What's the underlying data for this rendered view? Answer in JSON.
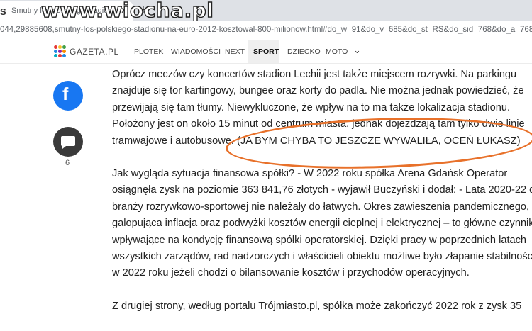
{
  "browser": {
    "favicon": "S",
    "tab_title": "Smutny los polskiego stadionu n",
    "close_icon": "close-icon",
    "new_tab_icon": "plus-icon",
    "url": "044,29885608,smutny-los-polskiego-stadionu-na-euro-2012-kosztowal-800-milionow.html#do_w=91&do_v=685&do_st=RS&do_sid=768&do_a=768&"
  },
  "watermark": "www.wiocha.pl",
  "site": {
    "logo_text": "GAZETA.PL",
    "nav": [
      "PLOTEK",
      "WIADOMOŚCI",
      "NEXT",
      "SPORT",
      "DZIECKO",
      "MOTO"
    ],
    "active": "SPORT",
    "more_icon": "chevron-down-icon"
  },
  "share": {
    "facebook_icon": "facebook-icon",
    "comment_icon": "comment-icon",
    "comment_count": "6"
  },
  "article": {
    "p1": [
      "Oprócz meczów czy koncertów stadion Lechii jest także miejscem rozrywki. Na parkingu",
      "znajduje się tor kartingowy, bungee oraz korty do padla. Nie można jednak powiedzieć, że",
      "przewijają się tam tłumy. Niewykluczone, że wpływ na to ma także lokalizacja stadionu.",
      "Położony jest on około 15 minut od centrum miasta, jednak dojeżdżają tam tylko dwie linie",
      "tramwajowe i autobusowe."
    ],
    "annotation": "(JA BYM CHYBA TO JESZCZE WYWALIŁA, OCEŃ ŁUKASZ)",
    "p2": [
      "Jak wygląda sytuacja finansowa spółki? - W 2022 roku spółka Arena Gdańsk Operator",
      "osiągnęła zysk na poziomie 363 841,76 złotych - wyjawił Buczyński i dodał: - Lata 2020-22 dla",
      "branży rozrywkowo-sportowej nie należały do łatwych. Okres zawieszenia pandemicznego,",
      "galopująca inflacja oraz podwyżki kosztów energii cieplnej i elektrycznej – to główne czynniki",
      "wpływające na kondycję finansową spółki operatorskiej. Dzięki pracy w poprzednich latach",
      "wszystkich zarządów, rad nadzorczych i właścicieli obiektu możliwe było złapanie stabilności",
      "w 2022 roku jeżeli chodzi o bilansowanie kosztów i przychodów operacyjnych."
    ],
    "p3": "Z drugiej strony, według portalu Trójmiasto.pl, spółka może zakończyć 2022 rok z zysk 35"
  },
  "colors": {
    "annotation_oval": "#e8712a",
    "facebook": "#1877f2"
  }
}
